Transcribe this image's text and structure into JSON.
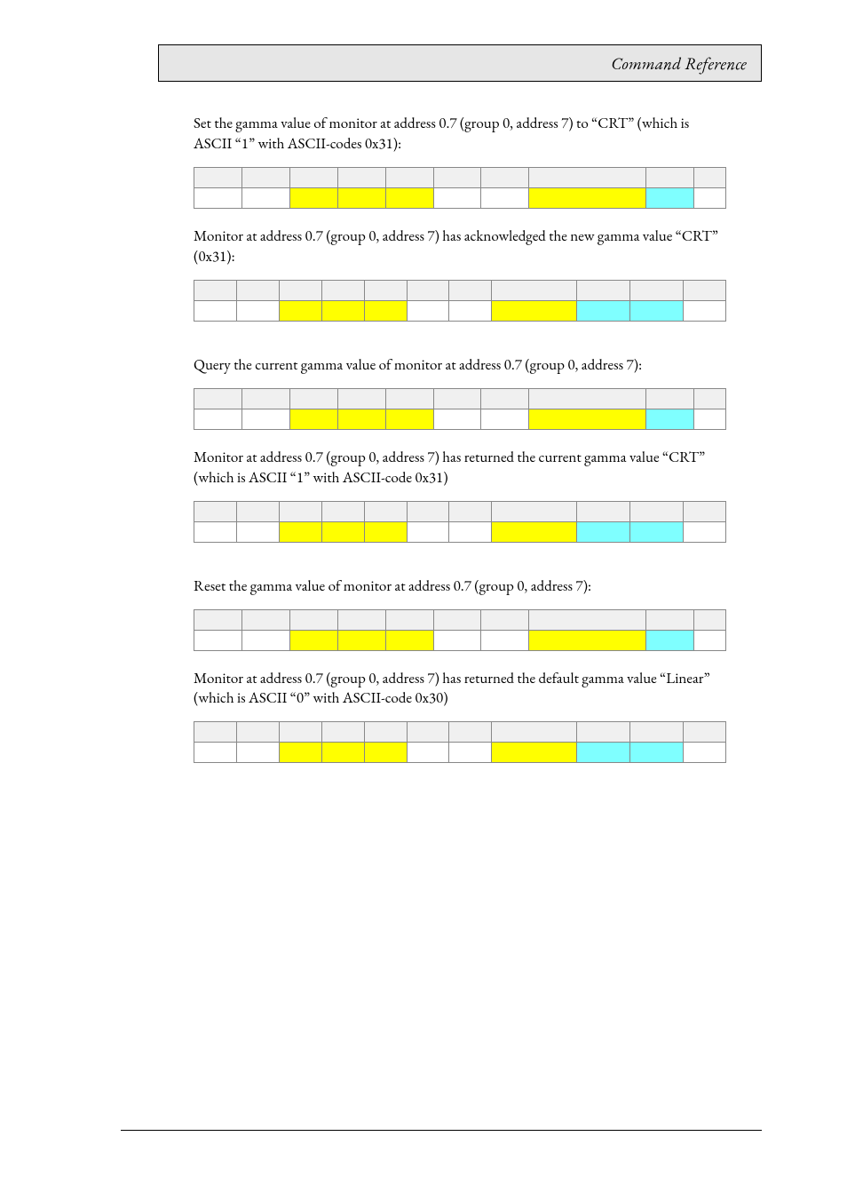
{
  "header": {
    "title": "Command Reference"
  },
  "sections": [
    {
      "intro": "Set the gamma value of monitor at address 0.7 (group 0, address 7) to “CRT” (which is ASCII “1” with ASCII-codes 0x31):",
      "cols": 10,
      "row2colors": [
        "c-white",
        "c-white",
        "c-yellow",
        "c-yellow",
        "c-yellow",
        "c-white",
        "c-white",
        "c-yellow",
        "c-cyan",
        "c-white"
      ],
      "outro": "Monitor at address 0.7 (group 0, address 7) has acknowledged the new gamma value “CRT” (0x31):"
    },
    {
      "cols": 11,
      "row2colors": [
        "c-white",
        "c-white",
        "c-yellow",
        "c-yellow",
        "c-yellow",
        "c-white",
        "c-white",
        "c-yellow",
        "c-cyan",
        "c-cyan",
        "c-white"
      ]
    },
    {
      "gap": true,
      "intro": "Query the current gamma value of monitor at address 0.7 (group 0, address 7):",
      "cols": 10,
      "row2colors": [
        "c-white",
        "c-white",
        "c-yellow",
        "c-yellow",
        "c-yellow",
        "c-white",
        "c-white",
        "c-yellow",
        "c-cyan",
        "c-white"
      ],
      "outro": "Monitor  at address 0.7 (group 0, address 7) has returned the current gamma value “CRT” (which is ASCII “1” with ASCII-code 0x31)"
    },
    {
      "cols": 11,
      "row2colors": [
        "c-white",
        "c-white",
        "c-yellow",
        "c-yellow",
        "c-yellow",
        "c-white",
        "c-white",
        "c-yellow",
        "c-cyan",
        "c-cyan",
        "c-white"
      ]
    },
    {
      "gap": true,
      "intro": "Reset the gamma value of monitor  at address 0.7 (group 0, address 7):",
      "cols": 10,
      "row2colors": [
        "c-white",
        "c-white",
        "c-yellow",
        "c-yellow",
        "c-yellow",
        "c-white",
        "c-white",
        "c-yellow",
        "c-cyan",
        "c-white"
      ],
      "outro": "Monitor  at address 0.7 (group 0, address 7) has returned the default gamma value “Linear” (which is ASCII “0” with ASCII-code 0x30)"
    },
    {
      "cols": 11,
      "row2colors": [
        "c-white",
        "c-white",
        "c-yellow",
        "c-yellow",
        "c-yellow",
        "c-white",
        "c-white",
        "c-yellow",
        "c-cyan",
        "c-cyan",
        "c-white"
      ]
    }
  ]
}
